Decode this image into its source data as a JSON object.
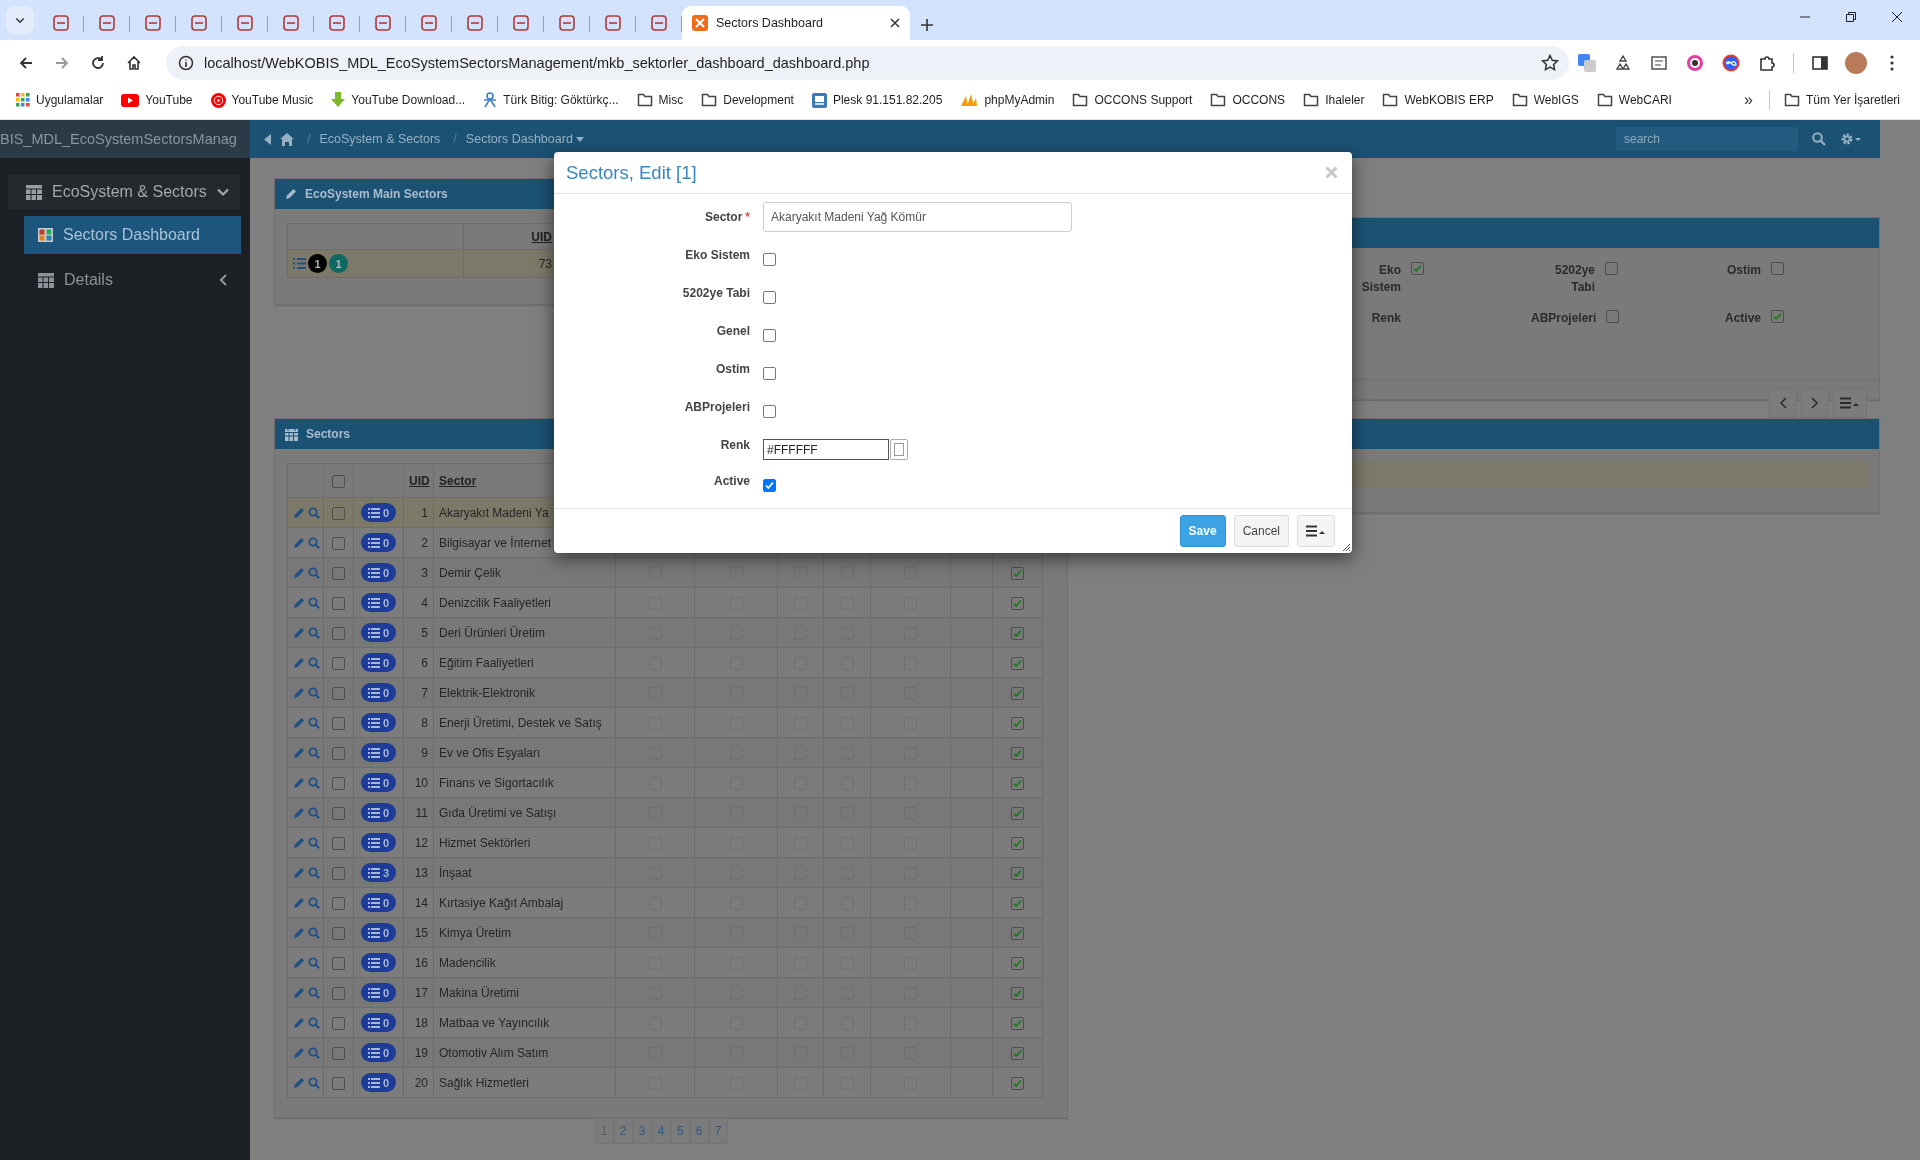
{
  "browser": {
    "tabs": [
      {
        "selected": false
      },
      {
        "selected": false
      },
      {
        "selected": false
      },
      {
        "selected": false
      },
      {
        "selected": false
      },
      {
        "selected": false
      },
      {
        "selected": false
      },
      {
        "selected": false
      },
      {
        "selected": false
      },
      {
        "selected": false
      },
      {
        "selected": false
      },
      {
        "selected": false
      },
      {
        "selected": false
      },
      {
        "selected": false
      },
      {
        "title": "Sectors Dashboard",
        "selected": true
      }
    ],
    "url": "localhost/WebKOBIS_MDL_EcoSystemSectorsManagement/mkb_sektorler_dashboard_dashboard.php",
    "bookmarks": [
      {
        "label": "Uygulamalar",
        "kind": "apps"
      },
      {
        "label": "YouTube",
        "kind": "youtube"
      },
      {
        "label": "YouTube Music",
        "kind": "music"
      },
      {
        "label": "YouTube Download...",
        "kind": "download"
      },
      {
        "label": "Türk Bitig: Göktürkç...",
        "kind": "figure"
      },
      {
        "label": "Misc",
        "kind": "folder"
      },
      {
        "label": "Development",
        "kind": "folder"
      },
      {
        "label": "Plesk 91.151.82.205",
        "kind": "site"
      },
      {
        "label": "phpMyAdmin",
        "kind": "pma"
      },
      {
        "label": "OCCONS Support",
        "kind": "folder"
      },
      {
        "label": "OCCONS",
        "kind": "folder"
      },
      {
        "label": "Ihaleler",
        "kind": "folder"
      },
      {
        "label": "WebKOBIS ERP",
        "kind": "folder"
      },
      {
        "label": "WebIGS",
        "kind": "folder"
      },
      {
        "label": "WebCARI",
        "kind": "folder"
      }
    ],
    "more_bookmarks": "»",
    "all_bookmarks": "Tüm Yer İşaretleri"
  },
  "app": {
    "title": "BIS_MDL_EcoSystemSectorsManag",
    "breadcrumb": [
      {
        "separator": "/",
        "label": "EcoSystem & Sectors",
        "dropdown": false
      },
      {
        "separator": "/",
        "label": "Sectors Dashboard",
        "dropdown": true
      }
    ],
    "search": {
      "placeholder": "search"
    }
  },
  "sidebar": {
    "group": {
      "label": "EcoSystem & Sectors",
      "expanded": true
    },
    "items": [
      {
        "label": "Sectors Dashboard",
        "kind": "page",
        "selected": true
      },
      {
        "label": "Details",
        "kind": "submenu",
        "selected": false
      }
    ]
  },
  "main_sectors": {
    "title": "EcoSystem Main Sectors",
    "columns": [
      "UID"
    ],
    "rows": [
      {
        "uid": "73",
        "selected": true,
        "badges": [
          {
            "text": "1",
            "color": "#000000"
          },
          {
            "text": "1",
            "color": "#0c6a62"
          }
        ]
      }
    ]
  },
  "record": {
    "fields": [
      {
        "label": "Eko Sistem",
        "kind": "checkbox",
        "checked": true
      },
      {
        "label": "5202ye Tabi",
        "kind": "checkbox",
        "checked": false
      },
      {
        "label": "Ostim",
        "kind": "checkbox",
        "checked": false
      },
      {
        "label": "Renk",
        "kind": "color"
      },
      {
        "label": "ABProjeleri",
        "kind": "checkbox",
        "checked": false
      },
      {
        "label": "Active",
        "kind": "checkbox",
        "checked": true
      }
    ]
  },
  "detail_panel": {
    "rows": [
      {
        "selected": true
      }
    ]
  },
  "sectors": {
    "title": "Sectors",
    "columns": [
      "UID",
      "Sector"
    ],
    "select_all": {
      "checked": false
    },
    "rows": [
      {
        "uid": "1",
        "sector": "Akaryakıt Madeni Ya",
        "count": "0",
        "checked": false,
        "selected": true
      },
      {
        "uid": "2",
        "sector": "Bilgisayar ve İnternet",
        "count": "0",
        "checked": false,
        "selected": false
      },
      {
        "uid": "3",
        "sector": "Demir Çelik",
        "count": "0",
        "checked": false,
        "selected": false,
        "flags": [
          false,
          false,
          false,
          false,
          false
        ],
        "active": true
      },
      {
        "uid": "4",
        "sector": "Denizcilik Faaliyetleri",
        "count": "0",
        "checked": false,
        "selected": false,
        "flags": [
          false,
          false,
          false,
          false,
          false
        ],
        "active": true
      },
      {
        "uid": "5",
        "sector": "Deri Ürünleri Üretim",
        "count": "0",
        "checked": false,
        "selected": false,
        "flags": [
          false,
          false,
          false,
          false,
          false
        ],
        "active": true
      },
      {
        "uid": "6",
        "sector": "Eğitim Faaliyetleri",
        "count": "0",
        "checked": false,
        "selected": false,
        "flags": [
          false,
          false,
          false,
          false,
          false
        ],
        "active": true
      },
      {
        "uid": "7",
        "sector": "Elektrik-Elektronik",
        "count": "0",
        "checked": false,
        "selected": false,
        "flags": [
          false,
          false,
          false,
          false,
          false
        ],
        "active": true
      },
      {
        "uid": "8",
        "sector": "Enerji Üretimi, Destek ve Satış",
        "count": "0",
        "checked": false,
        "selected": false,
        "flags": [
          false,
          false,
          false,
          false,
          false
        ],
        "active": true
      },
      {
        "uid": "9",
        "sector": "Ev ve Ofis Eşyaları",
        "count": "0",
        "checked": false,
        "selected": false,
        "flags": [
          false,
          false,
          false,
          false,
          false
        ],
        "active": true
      },
      {
        "uid": "10",
        "sector": "Finans ve Sigortacılık",
        "count": "0",
        "checked": false,
        "selected": false,
        "flags": [
          false,
          false,
          false,
          false,
          false
        ],
        "active": true
      },
      {
        "uid": "11",
        "sector": "Gıda Üretimi ve Satışı",
        "count": "0",
        "checked": false,
        "selected": false,
        "flags": [
          false,
          false,
          false,
          false,
          false
        ],
        "active": true
      },
      {
        "uid": "12",
        "sector": "Hizmet Sektörleri",
        "count": "0",
        "checked": false,
        "selected": false,
        "flags": [
          false,
          false,
          false,
          false,
          false
        ],
        "active": true
      },
      {
        "uid": "13",
        "sector": "İnşaat",
        "count": "3",
        "checked": false,
        "selected": false,
        "flags": [
          false,
          false,
          false,
          false,
          false
        ],
        "active": true
      },
      {
        "uid": "14",
        "sector": "Kırtasiye Kağıt Ambalaj",
        "count": "0",
        "checked": false,
        "selected": false,
        "flags": [
          false,
          false,
          false,
          false,
          false
        ],
        "active": true
      },
      {
        "uid": "15",
        "sector": "Kimya Üretim",
        "count": "0",
        "checked": false,
        "selected": false,
        "flags": [
          false,
          false,
          false,
          false,
          false
        ],
        "active": true
      },
      {
        "uid": "16",
        "sector": "Madencilik",
        "count": "0",
        "checked": false,
        "selected": false,
        "flags": [
          false,
          false,
          false,
          false,
          false
        ],
        "active": true
      },
      {
        "uid": "17",
        "sector": "Makina Üretimi",
        "count": "0",
        "checked": false,
        "selected": false,
        "flags": [
          false,
          false,
          false,
          false,
          false
        ],
        "active": true
      },
      {
        "uid": "18",
        "sector": "Matbaa ve Yayıncılık",
        "count": "0",
        "checked": false,
        "selected": false,
        "flags": [
          false,
          false,
          false,
          false,
          false
        ],
        "active": true
      },
      {
        "uid": "19",
        "sector": "Otomotiv Alım Satım",
        "count": "0",
        "checked": false,
        "selected": false,
        "flags": [
          false,
          false,
          false,
          false,
          false
        ],
        "active": true
      },
      {
        "uid": "20",
        "sector": "Sağlık Hizmetleri",
        "count": "0",
        "checked": false,
        "selected": false,
        "flags": [
          false,
          false,
          false,
          false,
          false
        ],
        "active": true
      }
    ],
    "pages": [
      {
        "label": "1",
        "selected": true
      },
      {
        "label": "2",
        "selected": false
      },
      {
        "label": "3",
        "selected": false
      },
      {
        "label": "4",
        "selected": false
      },
      {
        "label": "5",
        "selected": false
      },
      {
        "label": "6",
        "selected": false
      },
      {
        "label": "7",
        "selected": false
      }
    ]
  },
  "dialog": {
    "title": "Sectors, Edit [1]",
    "fields": [
      {
        "label": "Sector",
        "kind": "text",
        "required_mark": "*",
        "value": "Akaryakıt Madeni Yağ Kömür"
      },
      {
        "label": "Eko Sistem",
        "kind": "checkbox",
        "checked": false
      },
      {
        "label": "5202ye Tabi",
        "kind": "checkbox",
        "checked": false
      },
      {
        "label": "Genel",
        "kind": "checkbox",
        "checked": false
      },
      {
        "label": "Ostim",
        "kind": "checkbox",
        "checked": false
      },
      {
        "label": "ABProjeleri",
        "kind": "checkbox",
        "checked": false
      },
      {
        "label": "Renk",
        "kind": "color",
        "value": "#FFFFFF"
      },
      {
        "label": "Active",
        "kind": "checkbox",
        "checked": true
      }
    ],
    "buttons": [
      {
        "label": "Save",
        "kind": "primary"
      },
      {
        "label": "Cancel",
        "kind": "default"
      }
    ]
  }
}
